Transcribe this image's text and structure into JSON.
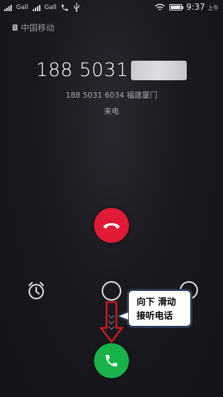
{
  "status_bar": {
    "sim1_label": "Gall",
    "sim2_label": "Gall",
    "time": "9:37",
    "time_suffix": "上午"
  },
  "carrier": {
    "name": "中国移动",
    "sim_slot": "1"
  },
  "caller": {
    "number_visible": "188 5031",
    "number_full": "188 5031 6034",
    "location": "福建厦门",
    "status": "来电"
  },
  "annotation": {
    "line1": "向下 滑动",
    "line2": "接听电话"
  },
  "colors": {
    "decline": "#e11b35",
    "answer": "#19b24a",
    "annotation_border": "#2b3d57",
    "arrow": "#d11a1a"
  },
  "icons": {
    "decline": "phone-hangup-icon",
    "answer": "phone-answer-icon",
    "alarm": "alarm-clock-icon"
  }
}
